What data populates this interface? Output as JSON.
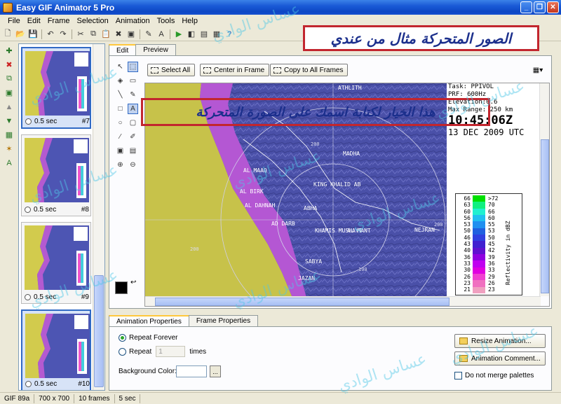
{
  "window": {
    "title": "Easy GIF Animator 5 Pro"
  },
  "menu": [
    "File",
    "Edit",
    "Frame",
    "Selection",
    "Animation",
    "Tools",
    "Help"
  ],
  "frames": [
    {
      "delay": "0.5 sec",
      "number": "#7"
    },
    {
      "delay": "0.5 sec",
      "number": "#8"
    },
    {
      "delay": "0.5 sec",
      "number": "#9"
    },
    {
      "delay": "0.5 sec",
      "number": "#10"
    }
  ],
  "edit_tabs": {
    "edit": "Edit",
    "preview": "Preview"
  },
  "actions": {
    "select_all": "Select All",
    "center": "Center in Frame",
    "copy_all": "Copy to All Frames"
  },
  "radar": {
    "task": "Task: PPIVOL",
    "prf": "PRF: 600Hz",
    "elevation": "Elevation:0.6",
    "range": "Max Range: 250 km",
    "time": "10:45:06Z",
    "date": "13 DEC 2009 UTC",
    "scale_title": "Reflectivity in dBZ",
    "scale_left": [
      "66",
      "63",
      "60",
      "56",
      "53",
      "50",
      "46",
      "43",
      "40",
      "36",
      "33",
      "30",
      "26",
      "23",
      "21"
    ],
    "scale_right": [
      ">72",
      "70",
      "66",
      "60",
      "55",
      "53",
      "50",
      "45",
      "42",
      "39",
      "36",
      "33",
      "29",
      "26",
      "23"
    ],
    "places": [
      "ATHLITH",
      "MADHA",
      "AL MAAQ",
      "KING KHALID AB",
      "AL BIRK",
      "AL DAHNAH",
      "AD DARB",
      "ABHA",
      "KHAMIS MUSHAYT",
      "NEJRAN",
      "AL MANT",
      "SABYA",
      "JAZAN"
    ],
    "rings": [
      "200",
      "200",
      "100",
      "200"
    ]
  },
  "prop_tabs": {
    "animation": "Animation Properties",
    "frame": "Frame Properties"
  },
  "props": {
    "repeat_forever": "Repeat Forever",
    "repeat": "Repeat",
    "repeat_count": "1",
    "times": "times",
    "background_color": "Background Color:",
    "dots": "...",
    "resize": "Resize Animation...",
    "comment": "Animation Comment...",
    "merge": "Do not merge palettes"
  },
  "status": {
    "format": "GIF 89a",
    "size": "700 x 700",
    "frames": "10 frames",
    "duration": "5 sec"
  },
  "banners": {
    "top": "الصور المتحركة مثال من عندي",
    "mid": "هذا الخيار لكتابة اسمك على الصورة المتحركة"
  },
  "watermark": "عساس الوادي",
  "colors": {
    "title_bar": "#1a5ad6",
    "banner_border": "#c2262e",
    "banner_text": "#1b2f8c",
    "radar_sea": "#c7c24a",
    "radar_land": "#4a50a8"
  }
}
